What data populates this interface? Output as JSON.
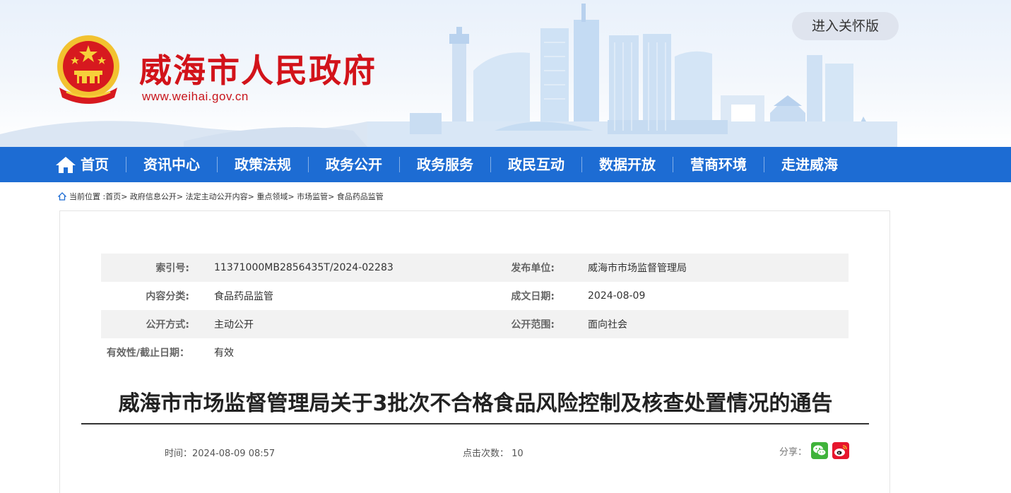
{
  "header": {
    "site_title": "威海市人民政府",
    "site_url": "www.weihai.gov.cn",
    "care_mode_button": "进入关怀版",
    "emblem_icon": "national-emblem-icon",
    "brand_color": "#d2131a"
  },
  "nav": {
    "color": "#1d6cd3",
    "home_icon": "home-icon",
    "items": [
      {
        "label": "首页"
      },
      {
        "label": "资讯中心"
      },
      {
        "label": "政策法规"
      },
      {
        "label": "政务公开"
      },
      {
        "label": "政务服务"
      },
      {
        "label": "政民互动"
      },
      {
        "label": "数据开放"
      },
      {
        "label": "营商环境"
      },
      {
        "label": "走进威海"
      }
    ]
  },
  "breadcrumb": {
    "prefix": "当前位置 :",
    "items": [
      "首页",
      "政府信息公开",
      "法定主动公开内容",
      "重点领域",
      "市场监管",
      "食品药品监管"
    ],
    "separator": ">"
  },
  "meta": {
    "index_label": "索引号:",
    "index_value": "11371000MB2856435T/2024-02283",
    "publisher_label": "发布单位:",
    "publisher_value": "威海市市场监督管理局",
    "category_label": "内容分类:",
    "category_value": "食品药品监管",
    "date_label": "成文日期:",
    "date_value": "2024-08-09",
    "method_label": "公开方式:",
    "method_value": "主动公开",
    "scope_label": "公开范围:",
    "scope_value": "面向社会",
    "validity_label": "有效性/截止日期：",
    "validity_value": "有效"
  },
  "article": {
    "title": "威海市市场监督管理局关于3批次不合格食品风险控制及核查处置情况的通告",
    "time_label": "时间：",
    "time_value": "2024-08-09 08:57",
    "views_label": "点击次数：",
    "views_value": "10",
    "share_label": "分享：",
    "share_icons": [
      "wechat-icon",
      "weibo-icon"
    ]
  }
}
